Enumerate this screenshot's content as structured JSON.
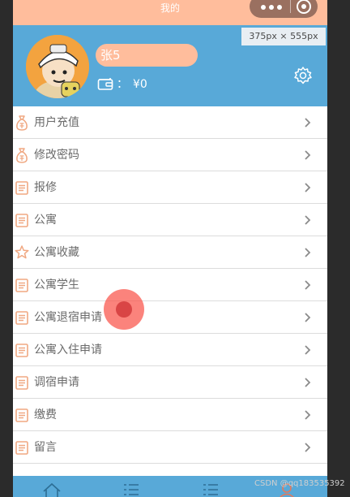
{
  "nav": {
    "title": "我的"
  },
  "overlay": {
    "viewport_label": "375px × 555px",
    "watermark": "CSDN @qq183535392"
  },
  "profile": {
    "name": "张5",
    "balance_separator": "：",
    "balance": "¥0"
  },
  "menu": [
    {
      "label": "用户充值",
      "icon": "money-bag-icon"
    },
    {
      "label": "修改密码",
      "icon": "money-bag-icon"
    },
    {
      "label": "报修",
      "icon": "document-list-icon"
    },
    {
      "label": "公寓",
      "icon": "document-list-icon"
    },
    {
      "label": "公寓收藏",
      "icon": "star-icon"
    },
    {
      "label": "公寓学生",
      "icon": "document-list-icon"
    },
    {
      "label": "公寓退宿申请",
      "icon": "document-list-icon"
    },
    {
      "label": "公寓入住申请",
      "icon": "document-list-icon"
    },
    {
      "label": "调宿申请",
      "icon": "document-list-icon"
    },
    {
      "label": "缴费",
      "icon": "document-list-icon"
    },
    {
      "label": "留言",
      "icon": "document-list-icon"
    }
  ],
  "colors": {
    "accent": "#ffbd9c",
    "header": "#58a9d8",
    "arrow": "#8a8a8a"
  }
}
